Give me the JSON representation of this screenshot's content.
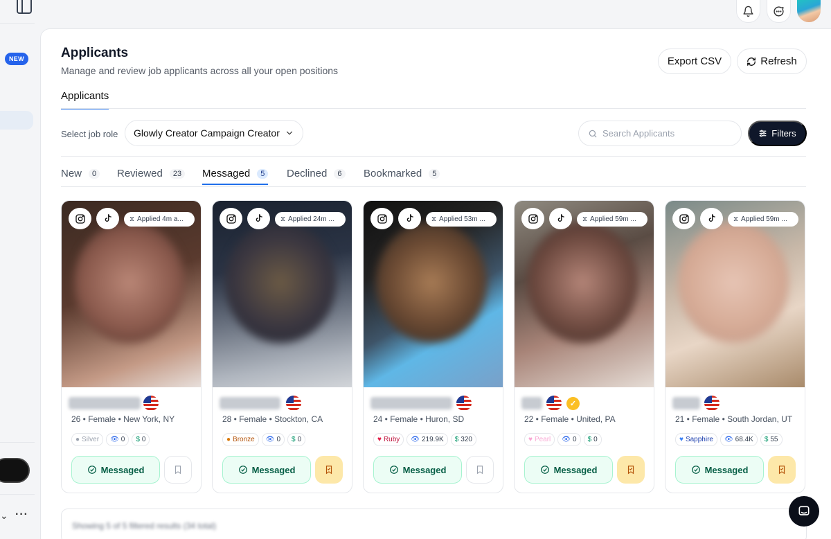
{
  "sidebar": {
    "new_badge": "NEW"
  },
  "page": {
    "title": "Applicants",
    "subtitle": "Manage and review job applicants across all your open positions",
    "export_label": "Export CSV",
    "refresh_label": "Refresh",
    "main_tab": "Applicants"
  },
  "filters": {
    "role_label": "Select job role",
    "role_value": "Glowly Creator Campaign Creator",
    "search_placeholder": "Search Applicants",
    "filters_label": "Filters"
  },
  "status_tabs": [
    {
      "label": "New",
      "count": "0"
    },
    {
      "label": "Reviewed",
      "count": "23"
    },
    {
      "label": "Messaged",
      "count": "5",
      "active": true
    },
    {
      "label": "Declined",
      "count": "6"
    },
    {
      "label": "Bookmarked",
      "count": "5"
    }
  ],
  "applicants": [
    {
      "applied": "Applied 4m a...",
      "meta": "26 • Female • New York, NY",
      "tier": "Silver",
      "tier_color": "#9ca3af",
      "views": "0",
      "earnings": "0",
      "status": "Messaged",
      "bookmarked": false,
      "verified": false
    },
    {
      "applied": "Applied 24m ...",
      "meta": "28 • Female • Stockton, CA",
      "tier": "Bronze",
      "tier_color": "#b45309",
      "views": "0",
      "earnings": "0",
      "status": "Messaged",
      "bookmarked": true,
      "verified": false
    },
    {
      "applied": "Applied 53m ...",
      "meta": "24 • Female • Huron, SD",
      "tier": "Ruby",
      "tier_color": "#be123c",
      "views": "219.9K",
      "earnings": "320",
      "status": "Messaged",
      "bookmarked": false,
      "verified": false
    },
    {
      "applied": "Applied 59m ...",
      "meta": "22 • Female • United, PA",
      "tier": "Pearl",
      "tier_color": "#f9a8d4",
      "views": "0",
      "earnings": "0",
      "status": "Messaged",
      "bookmarked": true,
      "verified": true
    },
    {
      "applied": "Applied 59m ...",
      "meta": "21 • Female • South Jordan, UT",
      "tier": "Sapphire",
      "tier_color": "#1e40af",
      "views": "68.4K",
      "earnings": "55",
      "status": "Messaged",
      "bookmarked": true,
      "verified": false
    }
  ],
  "footer": {
    "text": "Showing 5 of 5 filtered results (34 total)"
  },
  "colors": {
    "primary_dark": "#0f172a",
    "accent_blue": "#1f6feb",
    "messaged_green": "#065f46",
    "bookmark_yellow": "#fde8a9"
  }
}
